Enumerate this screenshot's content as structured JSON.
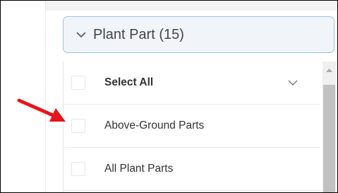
{
  "filter_panel": {
    "accordion_title": "Plant Part (15)",
    "options": [
      {
        "label": "Select All",
        "checked": false
      },
      {
        "label": "Above-Ground Parts",
        "checked": false
      },
      {
        "label": "All Plant Parts",
        "checked": false
      }
    ]
  },
  "colors": {
    "accordion_border": "#9fc3df",
    "accordion_background": "#f1f5f9",
    "annotation_arrow": "#e8151b"
  }
}
